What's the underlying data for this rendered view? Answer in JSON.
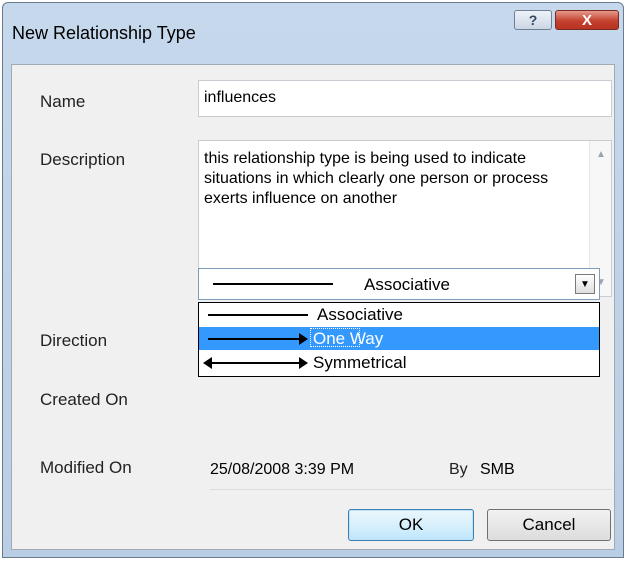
{
  "window": {
    "title": "New Relationship Type",
    "help_label": "?",
    "close_label": "X"
  },
  "form": {
    "name_label": "Name",
    "name_value": "influences",
    "description_label": "Description",
    "description_value": "this relationship type is being used to indicate situations in which clearly one person or process exerts influence on another",
    "direction_label": "Direction",
    "direction_selected": "Associative",
    "direction_options": [
      "Associative",
      "One Way",
      "Symmetrical"
    ],
    "highlighted_option": "One Way",
    "created_on_label": "Created On",
    "modified_on_label": "Modified On",
    "modified_on_value": "25/08/2008 3:39 PM",
    "by_label": "By",
    "by_value": "SMB"
  },
  "buttons": {
    "ok_label": "OK",
    "cancel_label": "Cancel"
  },
  "colors": {
    "selection": "#3399ff",
    "close_button": "#c4412e",
    "title_bar": "#c6d8ec"
  },
  "icons": {
    "help": "help-icon",
    "close": "close-icon",
    "dropdown": "chevron-down-icon",
    "scroll_up": "scroll-up-icon",
    "scroll_down": "scroll-down-icon"
  }
}
